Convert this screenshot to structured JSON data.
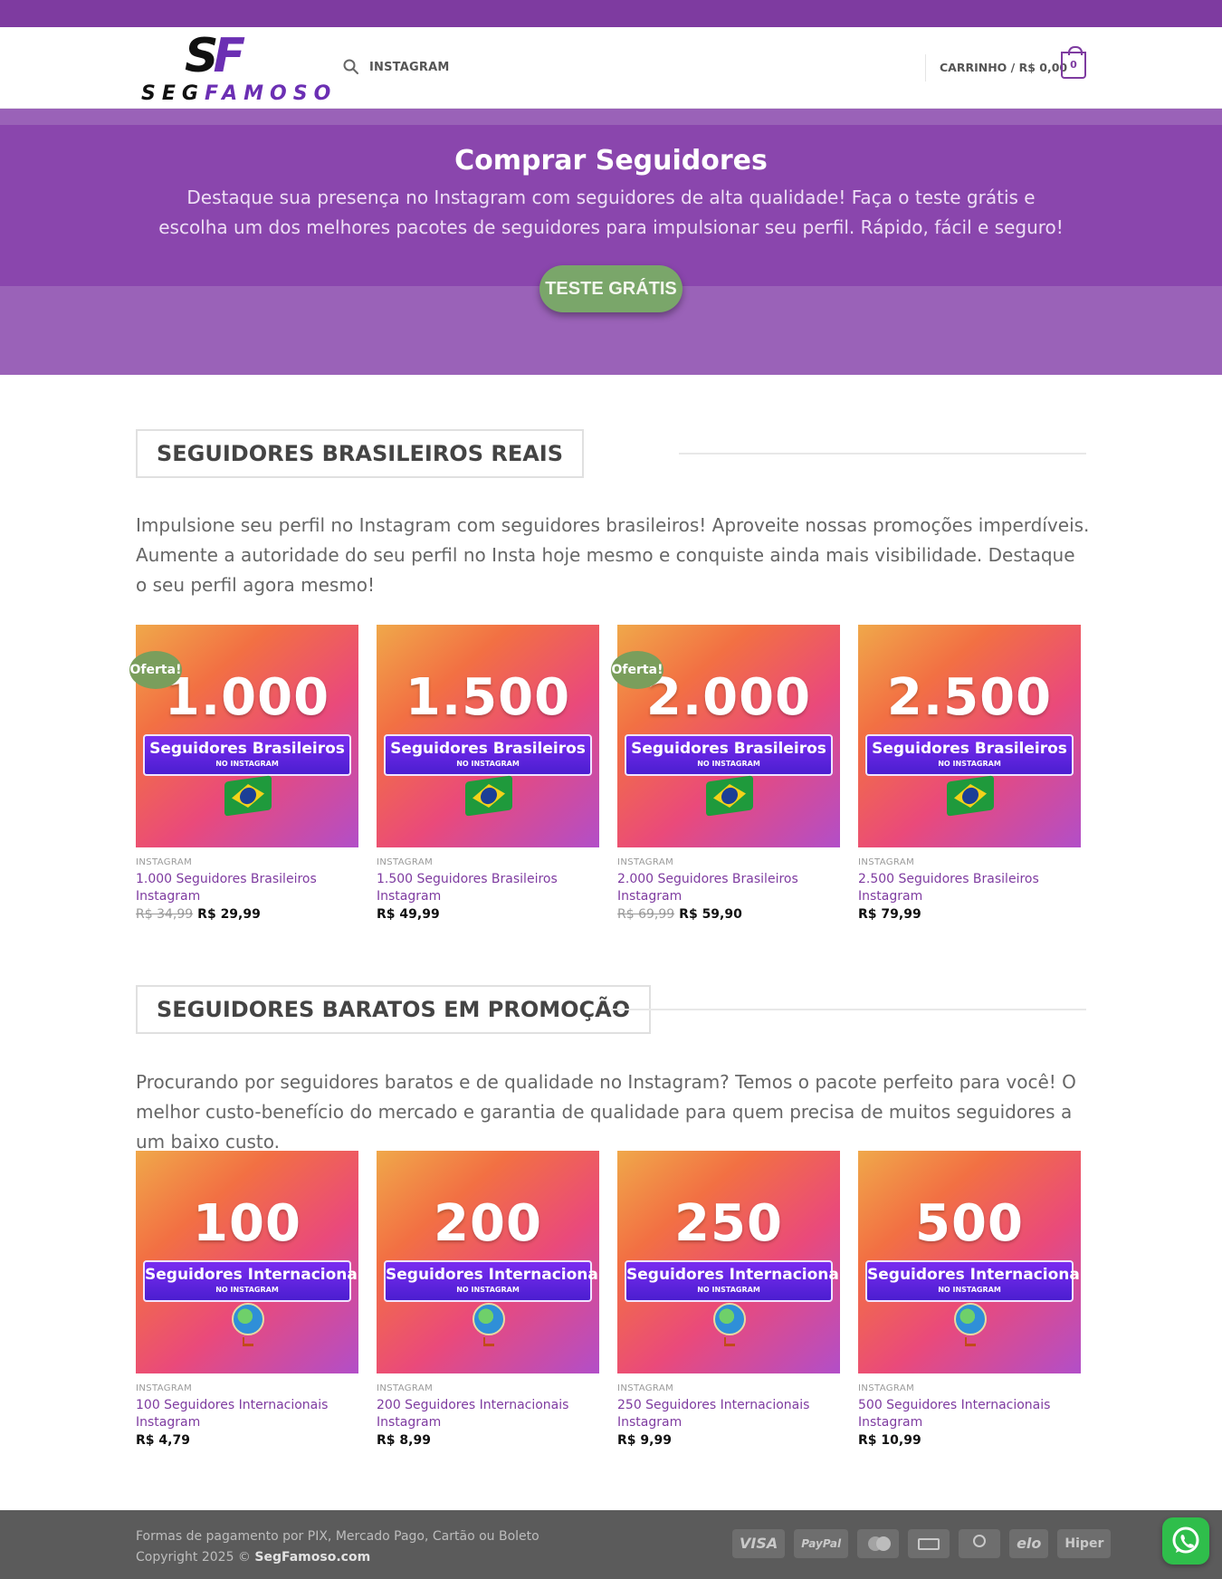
{
  "header": {
    "logo_mark": "SF",
    "logo_text_1": "SEG",
    "logo_text_2": "FAMOSO",
    "nav_link": "INSTAGRAM",
    "cart_label": "CARRINHO / R$ 0,00",
    "cart_count": "0",
    "accent_color": "#7e3ba0"
  },
  "hero": {
    "title": "Comprar Seguidores",
    "subtitle": "Destaque sua presença no Instagram com seguidores de alta qualidade! Faça o teste grátis e escolha um dos melhores pacotes de seguidores para impulsionar seu perfil. Rápido, fácil e seguro!",
    "button": "TESTE GRÁTIS"
  },
  "section1": {
    "title": "SEGUIDORES BRASILEIROS REAIS",
    "description": "Impulsione seu perfil no Instagram com seguidores brasileiros! Aproveite nossas promoções imperdíveis. Aumente a autoridade do seu perfil no Insta hoje mesmo e conquiste ainda mais visibilidade. Destaque o seu perfil agora mesmo!",
    "products": [
      {
        "img_number": "1.000",
        "img_ribbon": "Seguidores Brasileiros",
        "img_sub": "NO INSTAGRAM",
        "badge": "Oferta!",
        "category": "INSTAGRAM",
        "name": "1.000 Seguidores Brasileiros Instagram",
        "old_price": "R$ 34,99",
        "price": "R$ 29,99"
      },
      {
        "img_number": "1.500",
        "img_ribbon": "Seguidores Brasileiros",
        "img_sub": "NO INSTAGRAM",
        "badge": "",
        "category": "INSTAGRAM",
        "name": "1.500 Seguidores Brasileiros Instagram",
        "old_price": "",
        "price": "R$ 49,99"
      },
      {
        "img_number": "2.000",
        "img_ribbon": "Seguidores Brasileiros",
        "img_sub": "NO INSTAGRAM",
        "badge": "Oferta!",
        "category": "INSTAGRAM",
        "name": "2.000 Seguidores Brasileiros Instagram",
        "old_price": "R$ 69,99",
        "price": "R$ 59,90"
      },
      {
        "img_number": "2.500",
        "img_ribbon": "Seguidores Brasileiros",
        "img_sub": "NO INSTAGRAM",
        "badge": "",
        "category": "INSTAGRAM",
        "name": "2.500 Seguidores Brasileiros Instagram",
        "old_price": "",
        "price": "R$ 79,99"
      }
    ]
  },
  "section2": {
    "title": "SEGUIDORES BARATOS EM PROMOÇÃO",
    "description": "Procurando por seguidores baratos e de qualidade no Instagram? Temos o pacote perfeito para você! O melhor custo-benefício do mercado e garantia de qualidade para quem precisa de muitos seguidores a um baixo custo.",
    "products": [
      {
        "img_number": "100",
        "img_ribbon": "Seguidores Internacionais",
        "img_sub": "NO INSTAGRAM",
        "category": "INSTAGRAM",
        "name": "100 Seguidores Internacionais Instagram",
        "price": "R$ 4,79"
      },
      {
        "img_number": "200",
        "img_ribbon": "Seguidores Internacionais",
        "img_sub": "NO INSTAGRAM",
        "category": "INSTAGRAM",
        "name": "200 Seguidores Internacionais Instagram",
        "price": "R$ 8,99"
      },
      {
        "img_number": "250",
        "img_ribbon": "Seguidores Internacionais",
        "img_sub": "NO INSTAGRAM",
        "category": "INSTAGRAM",
        "name": "250 Seguidores Internacionais Instagram",
        "price": "R$ 9,99"
      },
      {
        "img_number": "500",
        "img_ribbon": "Seguidores Internacionais",
        "img_sub": "NO INSTAGRAM",
        "category": "INSTAGRAM",
        "name": "500 Seguidores Internacionais Instagram",
        "price": "R$ 10,99"
      }
    ]
  },
  "footer": {
    "payment_text": "Formas de pagamento por PIX, Mercado Pago, Cartão ou Boleto",
    "copyright_prefix": "Copyright 2025 © ",
    "copyright_brand": "SegFamoso.com",
    "payment_icons": [
      "VISA",
      "PayPal",
      "mastercard-icon",
      "cash-icon",
      "diners-club-icon",
      "elo",
      "Hiper"
    ]
  },
  "whatsapp": {
    "icon": "whatsapp-icon",
    "color": "#2fbe4b"
  }
}
